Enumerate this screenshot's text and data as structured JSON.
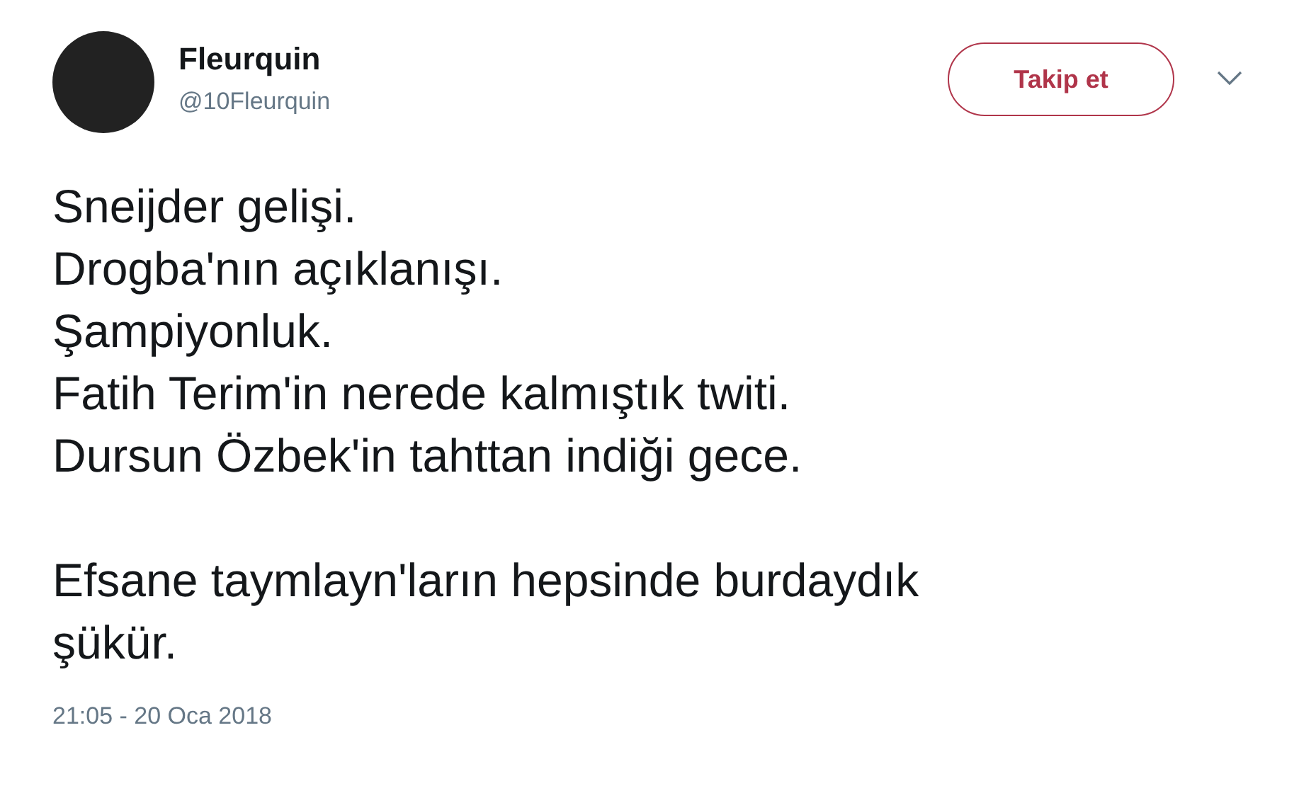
{
  "author": {
    "name": "Fleurquin",
    "handle": "@10Fleurquin"
  },
  "follow_button": {
    "label": "Takip et"
  },
  "tweet": {
    "paragraphs": [
      "Sneijder gelişi.\nDrogba'nın açıklanışı.\nŞampiyonluk.\nFatih Terim'in nerede kalmıştık twiti.\nDursun Özbek'in tahttan indiği gece.",
      "Efsane taymlayn'ların hepsinde burdaydık\nşükür."
    ]
  },
  "timestamp": "21:05 - 20 Oca 2018"
}
